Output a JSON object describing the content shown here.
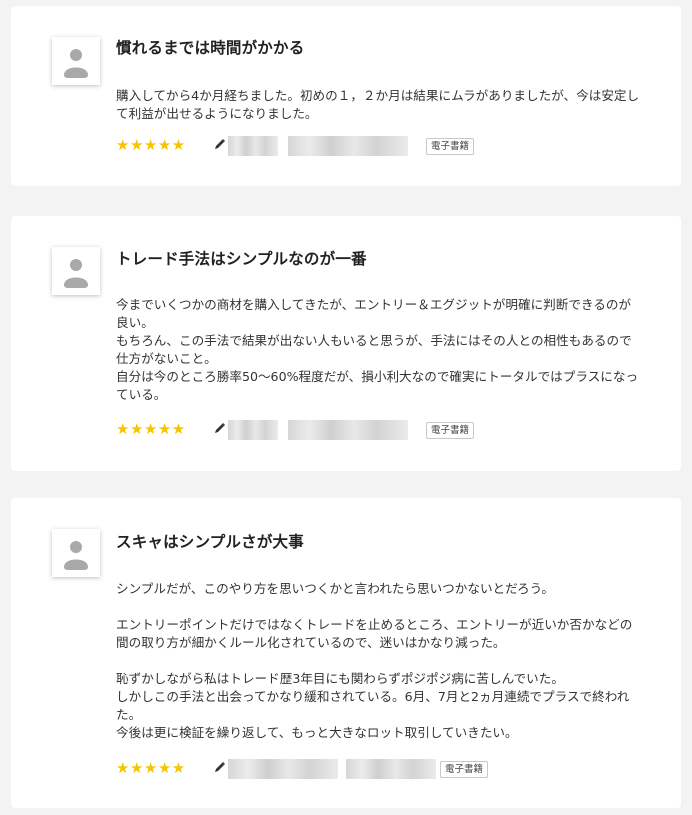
{
  "reviews": [
    {
      "title": "慣れるまでは時間がかかる",
      "body": [
        "購入してから4か月経ちました。初めの１，２か月は結果にムラがありましたが、今は安定して利益が出せるようになりました。"
      ],
      "rating": "★★★★★",
      "badge": "電子書籍",
      "icons": {
        "avatar": "user-avatar-icon",
        "pencil": "pencil-icon"
      }
    },
    {
      "title": "トレード手法はシンプルなのが一番",
      "body": [
        "今までいくつかの商材を購入してきたが、エントリー＆エグジットが明確に判断できるのが良い。",
        "もちろん、この手法で結果が出ない人もいると思うが、手法にはその人との相性もあるので仕方がないこと。",
        "自分は今のところ勝率50～60%程度だが、損小利大なので確実にトータルではプラスになっている。"
      ],
      "rating": "★★★★★",
      "badge": "電子書籍",
      "icons": {
        "avatar": "user-avatar-icon",
        "pencil": "pencil-icon"
      }
    },
    {
      "title": "スキャはシンプルさが大事",
      "body": [
        "シンプルだが、このやり方を思いつくかと言われたら思いつかないとだろう。",
        "",
        "エントリーポイントだけではなくトレードを止めるところ、エントリーが近いか否かなどの間の取り方が細かくルール化されているので、迷いはかなり減った。",
        "",
        "恥ずかしながら私はトレード歴3年目にも関わらずポジポジ病に苦しんでいた。",
        "しかしこの手法と出会ってかなり緩和されている。6月、7月と2ヵ月連続でプラスで終われた。",
        "今後は更に検証を繰り返して、もっと大きなロット取引していきたい。"
      ],
      "rating": "★★★★★",
      "badge": "電子書籍",
      "icons": {
        "avatar": "user-avatar-icon",
        "pencil": "pencil-icon"
      }
    }
  ]
}
